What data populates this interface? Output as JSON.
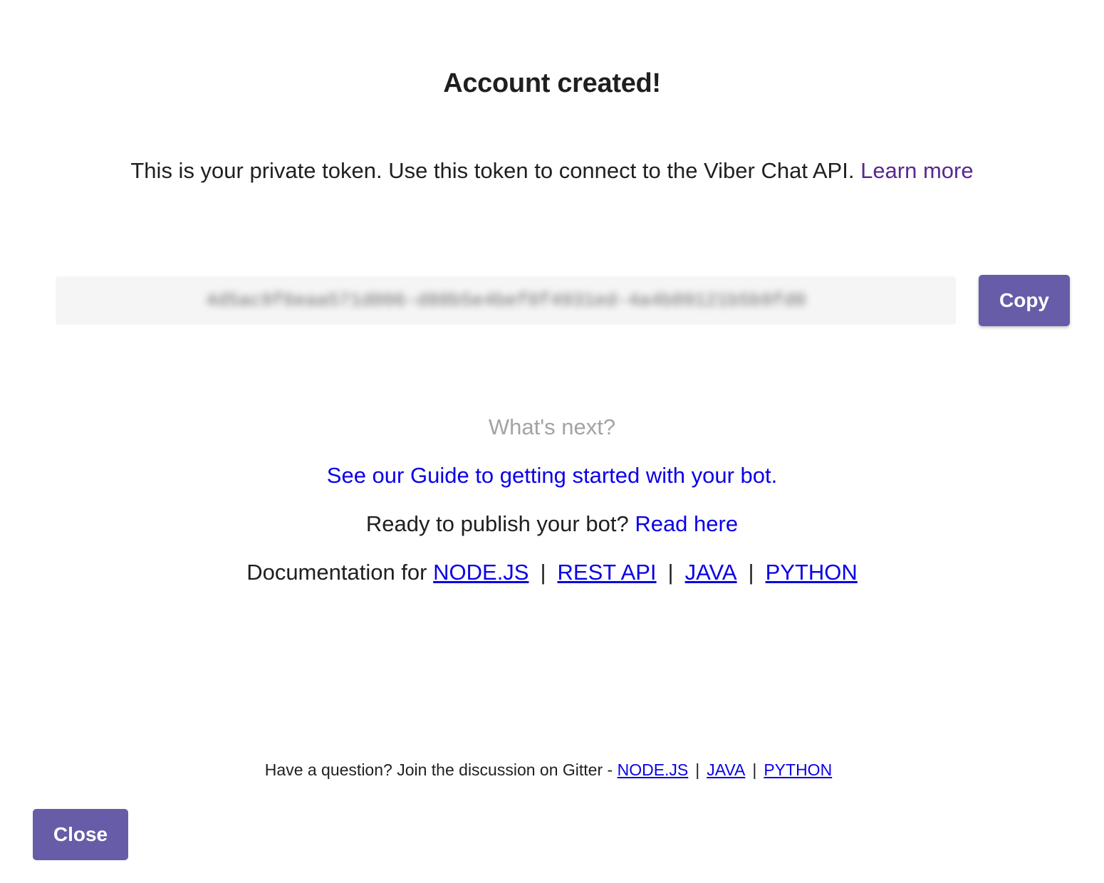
{
  "dialog": {
    "title": "Account created!",
    "description": "This is your private token. Use this token to connect to the Viber Chat API.",
    "learn_more": "Learn more"
  },
  "token": {
    "value": "4d5ac9f6eaa571d006-d88b5e4bef0f4931ed-4a4b09121b5b9fd0",
    "blurred": true,
    "copy_label": "Copy"
  },
  "next": {
    "heading": "What's next?",
    "guide_link": "See our Guide to getting started with your bot.",
    "publish_text": "Ready to publish your bot?",
    "publish_link": "Read here",
    "docs_text": "Documentation for",
    "docs_links": [
      "NODE.JS",
      "REST API",
      "JAVA",
      "PYTHON"
    ],
    "separator": "|"
  },
  "footer": {
    "text": "Have a question? Join the discussion on Gitter -",
    "links": [
      "NODE.JS",
      "JAVA",
      "PYTHON"
    ]
  },
  "close_label": "Close",
  "colors": {
    "accent": "#665ca7",
    "link": "#0a00e6",
    "learn_more": "#59288f",
    "muted": "#a3a3a3"
  }
}
